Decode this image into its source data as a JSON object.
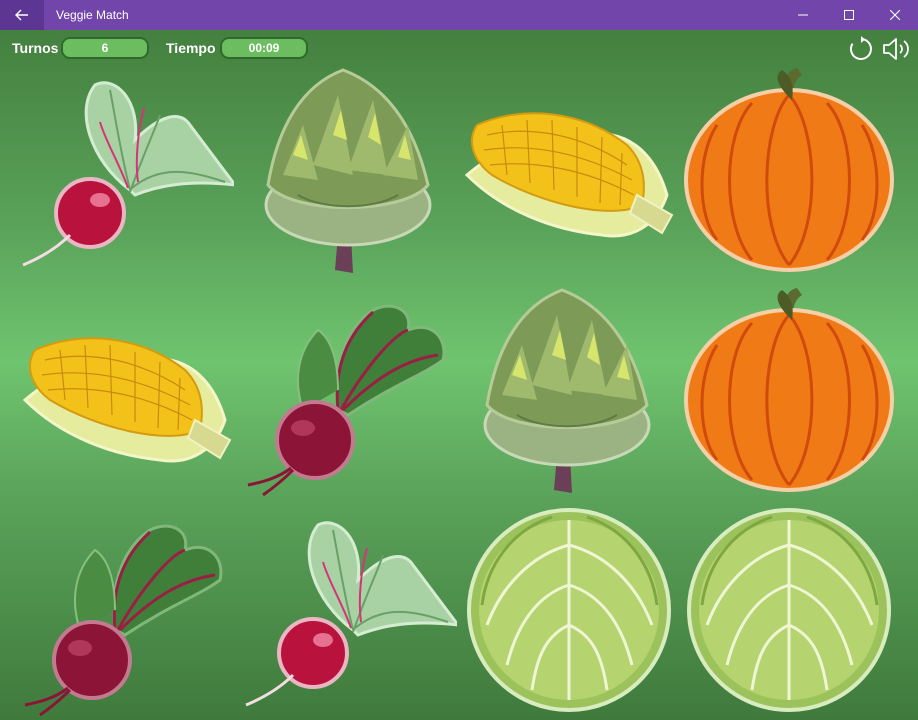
{
  "window": {
    "title": "Veggie Match"
  },
  "hud": {
    "turns_label": "Turnos",
    "turns_value": "6",
    "time_label": "Tiempo",
    "time_value": "00:09"
  },
  "icons": {
    "back": "back-arrow-icon",
    "minimize": "minimize-icon",
    "maximize": "maximize-icon",
    "close": "close-icon",
    "restart": "restart-icon",
    "sound": "sound-icon"
  },
  "colors": {
    "titlebar": "#7145a9",
    "board_light": "#6fc46f",
    "board_dark": "#3f7a3c",
    "pill": "#6bbd5f"
  },
  "cards": [
    [
      "radish",
      "artichoke",
      "corn",
      "pumpkin"
    ],
    [
      "corn",
      "beet",
      "artichoke",
      "pumpkin"
    ],
    [
      "beet",
      "radish",
      "cabbage",
      "cabbage"
    ]
  ]
}
